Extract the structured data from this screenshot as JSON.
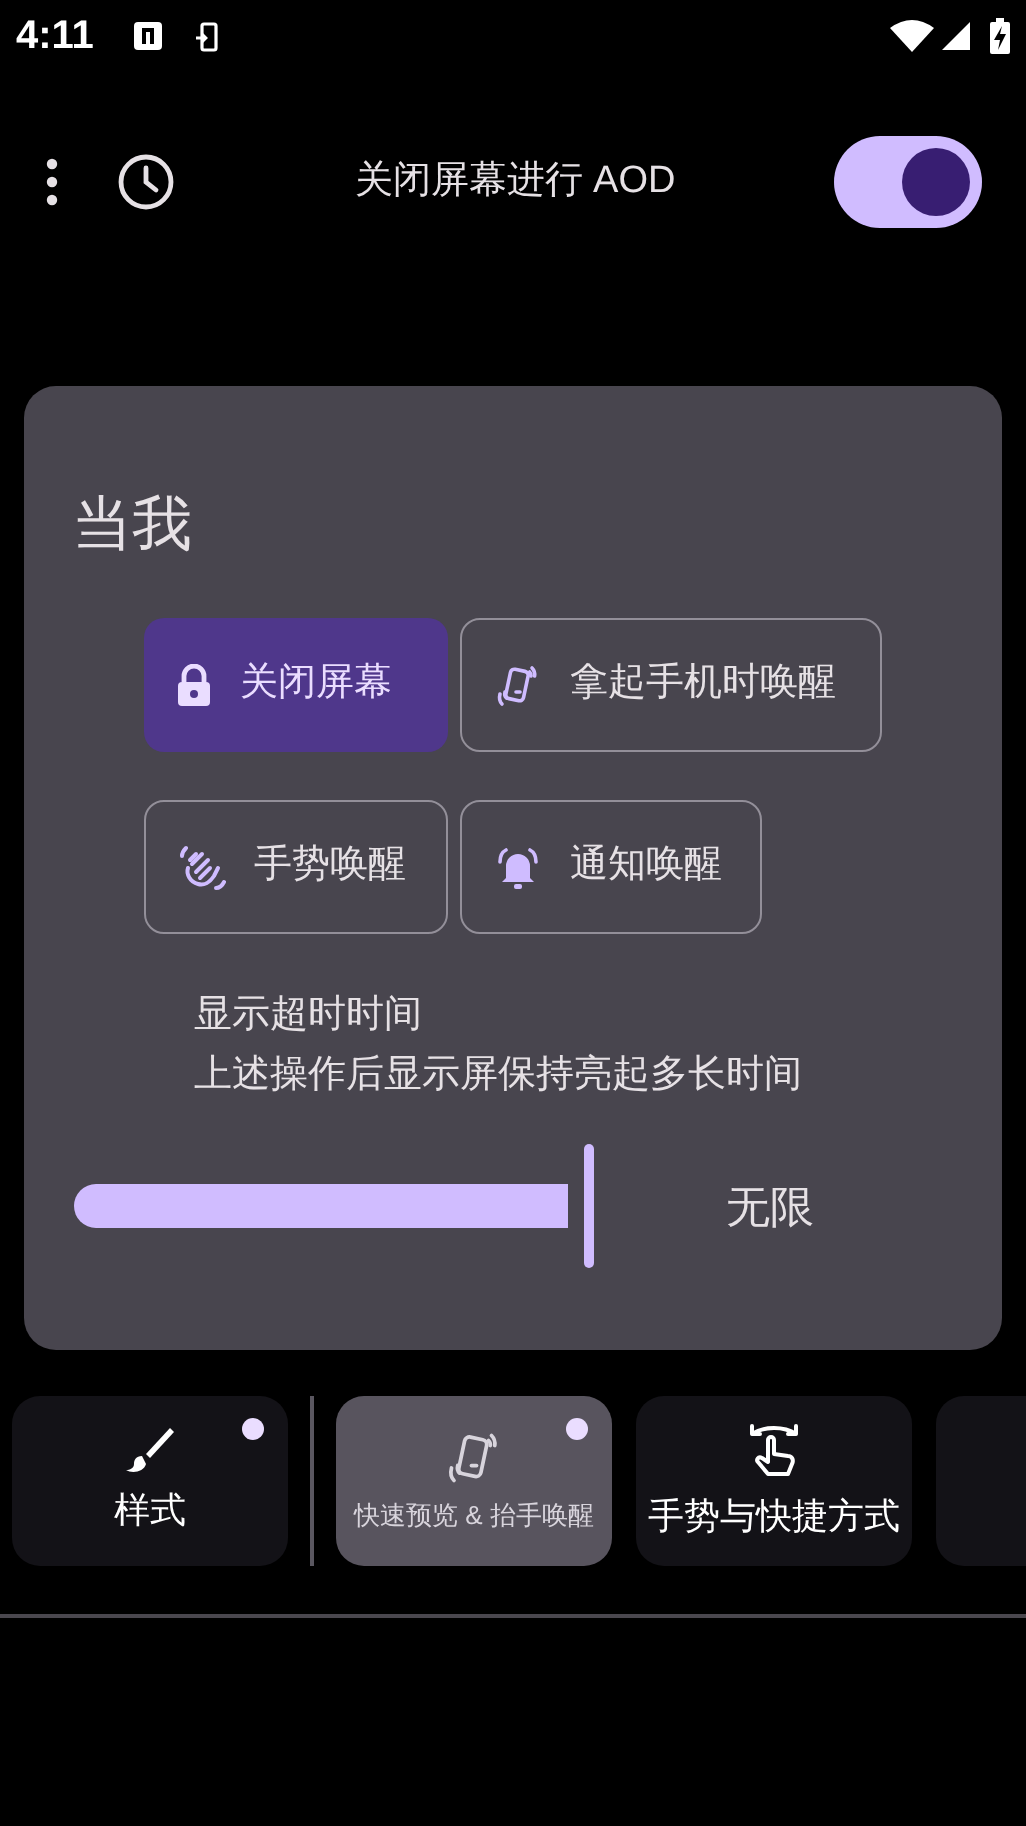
{
  "status_bar": {
    "time": "4:11"
  },
  "top_bar": {
    "title": "关闭屏幕进行 AOD",
    "toggle": {
      "on": true
    }
  },
  "panel": {
    "heading": "当我",
    "chips": [
      {
        "label": "关闭屏幕",
        "selected": true
      },
      {
        "label": "拿起手机时唤醒",
        "selected": false
      },
      {
        "label": "手势唤醒",
        "selected": false
      },
      {
        "label": "通知唤醒",
        "selected": false
      }
    ],
    "timeout_title": "显示超时时间",
    "timeout_description": "上述操作后显示屏保持亮起多长时间",
    "slider": {
      "level": 1,
      "reading": "无限"
    }
  },
  "tabs": [
    {
      "label": "样式",
      "selected": false,
      "badge": true
    },
    {
      "label": "快速预览 & 抬手唤醒",
      "selected": true,
      "badge": true
    },
    {
      "label": "手势与快捷方式",
      "selected": false,
      "badge": false
    }
  ]
}
